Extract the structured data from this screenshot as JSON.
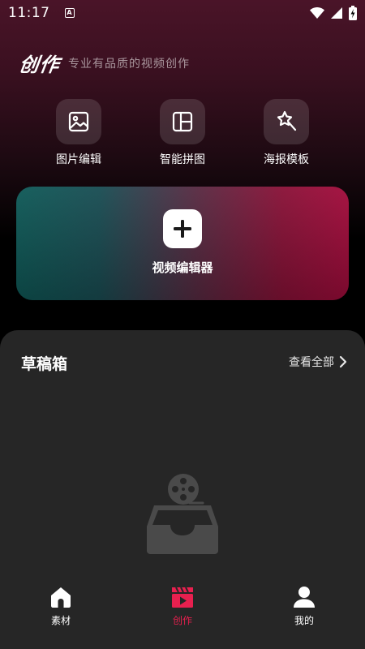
{
  "status_bar": {
    "time": "11:17",
    "notification_letter": "A"
  },
  "header": {
    "logo_text": "创作",
    "subtitle": "专业有品质的视频创作"
  },
  "tools": [
    {
      "label": "图片编辑",
      "icon": "image-icon"
    },
    {
      "label": "智能拼图",
      "icon": "collage-grid-icon"
    },
    {
      "label": "海报模板",
      "icon": "magic-wand-icon"
    }
  ],
  "video_editor": {
    "label": "视频编辑器",
    "icon": "plus-icon"
  },
  "drafts": {
    "title": "草稿箱",
    "view_all": "查看全部"
  },
  "bottom_nav": [
    {
      "label": "素材",
      "icon": "home-icon",
      "active": false
    },
    {
      "label": "创作",
      "icon": "clapperboard-play-icon",
      "active": true
    },
    {
      "label": "我的",
      "icon": "user-icon",
      "active": false
    }
  ],
  "colors": {
    "accent": "#e8204f",
    "panel_bg": "#262626",
    "card_gradient_left": "#0f5a58",
    "card_gradient_right": "#a30c3c"
  }
}
